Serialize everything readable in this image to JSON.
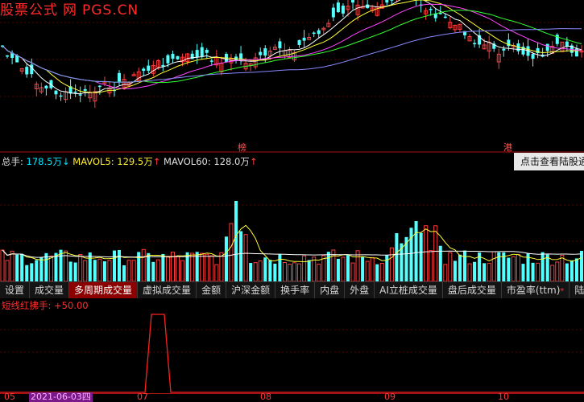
{
  "watermark": [
    "股票公式",
    "网",
    "PGS.CN"
  ],
  "annotations": [
    "榜",
    "港"
  ],
  "volume_legend": {
    "total_label": "总手:",
    "total_value": "178.5万",
    "total_arrow": "↓",
    "ma5_label": "MAVOL5:",
    "ma5_value": "129.5万",
    "ma5_arrow": "↑",
    "ma60_label": "MAVOL60:",
    "ma60_value": "128.0万",
    "ma60_arrow": "↑"
  },
  "tooltip": "点击查看陆股通",
  "tabs": [
    "设置",
    "成交量",
    "多周期成交量",
    "虚拟成交量",
    "金额",
    "沪深金额",
    "换手率",
    "内盘",
    "外盘",
    "AI立桩成交量",
    "盘后成交量",
    "市盈率(ttm)",
    "陆"
  ],
  "active_tab": "多周期成交量",
  "indicator_legend": {
    "name": "短线红拂手:",
    "value": "+50.00"
  },
  "xaxis": [
    "05",
    "2021-06-03四",
    "07",
    "08",
    "09",
    "10"
  ],
  "colors": {
    "up": "#ff3c3c",
    "down": "#54ffff",
    "ma5": "#ffffff",
    "ma10": "#ffff33",
    "ma20": "#ff44ff",
    "ma30": "#33ff33",
    "ma60": "#8888ff",
    "indicator": "#ff2020",
    "tab_active": "#8b0000"
  }
}
